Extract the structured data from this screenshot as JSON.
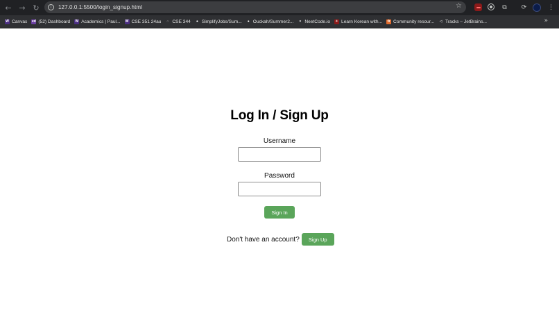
{
  "browser": {
    "url": "127.0.0.1:5500/login_signup.html",
    "nav": {
      "back": "←",
      "forward": "→",
      "reload": "↻"
    },
    "info_icon": "i",
    "star_icon": "☆",
    "extensions_icon": "⧉",
    "menu_icon": "⋮",
    "more_bookmarks": "»",
    "bookmarks": [
      {
        "label": "Canvas",
        "icon": "W",
        "color": "#4b2e83"
      },
      {
        "label": "(52) Dashboard",
        "icon": "ed",
        "color": "#6b3fa0"
      },
      {
        "label": "Academics | Paul...",
        "icon": "W",
        "color": "#4b2e83"
      },
      {
        "label": "CSE 351 24au",
        "icon": "W",
        "color": "#4b2e83"
      },
      {
        "label": "CSE 344",
        "icon": "◌",
        "color": "#2f3033"
      },
      {
        "label": "SimplifyJobs/Sum...",
        "icon": "●",
        "color": "#2f3033"
      },
      {
        "label": "Ouckah/Summer2...",
        "icon": "●",
        "color": "#2f3033"
      },
      {
        "label": "NeetCode.io",
        "icon": "▾",
        "color": "#2f3033"
      },
      {
        "label": "Learn Korean with...",
        "icon": "☀",
        "color": "#8b1a1a"
      },
      {
        "label": "Community resour...",
        "icon": "✿",
        "color": "#e06a2c"
      },
      {
        "label": "Tracks – JetBrains...",
        "icon": "◁",
        "color": "#2f3033"
      }
    ]
  },
  "form": {
    "title": "Log In / Sign Up",
    "username_label": "Username",
    "username_value": "",
    "password_label": "Password",
    "password_value": "",
    "signin_button": "Sign In",
    "no_account_text": "Don't have an account?",
    "signup_button": "Sign Up"
  },
  "colors": {
    "button_green": "#5aa55a",
    "chrome_dark": "#202124"
  }
}
